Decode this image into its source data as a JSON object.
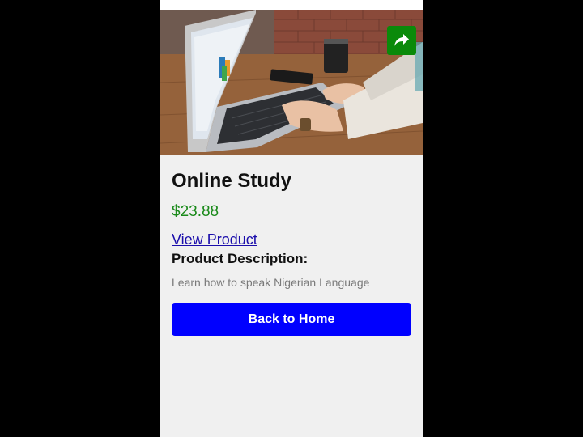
{
  "product": {
    "title": "Online Study",
    "price": "$23.88",
    "view_link": "View Product",
    "description_label": "Product Description:",
    "description": "Learn how to speak Nigerian Language"
  },
  "actions": {
    "back_home": "Back to Home"
  },
  "icons": {
    "share": "share-icon"
  },
  "colors": {
    "price": "#1a8a1a",
    "primary_button": "#0000ff",
    "share_button": "#0a8a0a",
    "link": "#1a0dab"
  }
}
